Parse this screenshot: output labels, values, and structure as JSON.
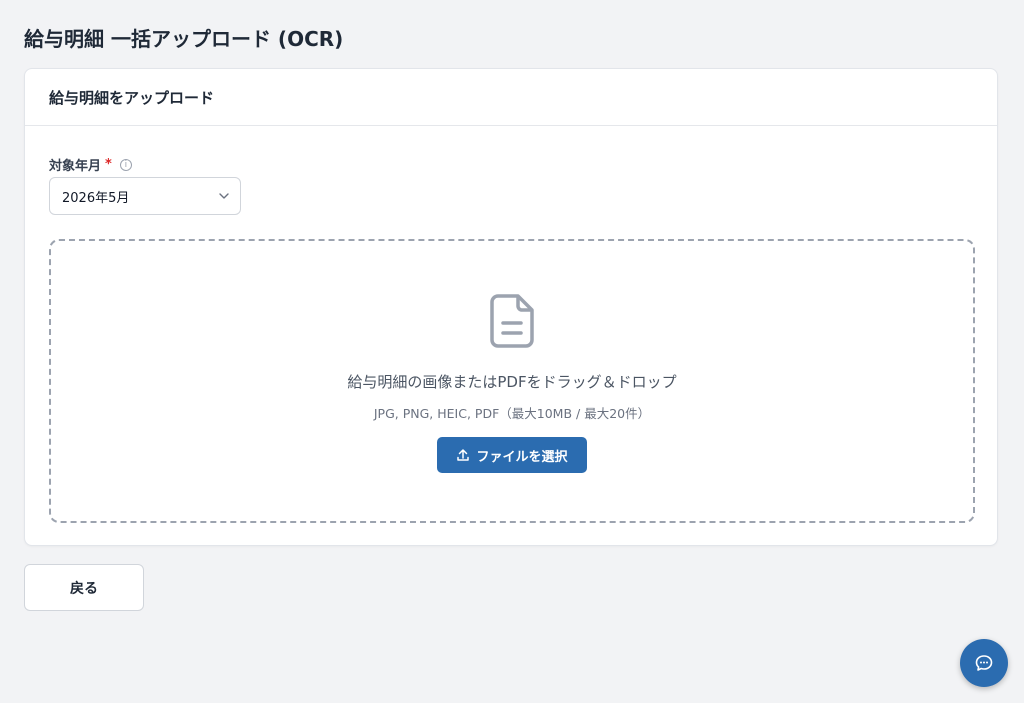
{
  "page": {
    "title": "給与明細 一括アップロード (OCR)"
  },
  "card": {
    "header": "給与明細をアップロード"
  },
  "target_month": {
    "label": "対象年月",
    "required_mark": "*",
    "info_glyph": "i",
    "selected_value": "2026年5月"
  },
  "dropzone": {
    "icon": "document-icon",
    "main_text": "給与明細の画像またはPDFをドラッグ＆ドロップ",
    "sub_text": "JPG, PNG, HEIC, PDF（最大10MB / 最大20件）",
    "button_label": "ファイルを選択",
    "button_icon": "upload-icon"
  },
  "footer": {
    "back_label": "戻る"
  },
  "chat": {
    "icon": "chat-bubble-icon"
  },
  "colors": {
    "accent": "#2b6cb0",
    "required": "#dc2626",
    "background": "#f2f3f5"
  }
}
